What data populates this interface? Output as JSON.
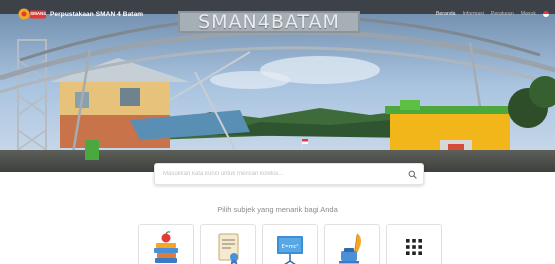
{
  "brand": {
    "logo_text": "SMAN4",
    "title": "Perpustakaan SMAN 4 Batam"
  },
  "nav": {
    "links": [
      "Beranda",
      "Informasi",
      "Peraturan",
      "Masuk"
    ],
    "flag_icon": "indonesia-flag-icon"
  },
  "hero": {
    "gate_sign": "SMAN4BATAM"
  },
  "search": {
    "placeholder": "Masukkan kata kunci untuk mencari koleksi...",
    "icon": "search-icon"
  },
  "subjects": {
    "heading": "Pilih subjek yang menarik bagi Anda",
    "items": [
      {
        "icon": "books-apple-icon"
      },
      {
        "icon": "certificate-document-icon"
      },
      {
        "icon": "presentation-board-icon"
      },
      {
        "icon": "ink-quill-icon"
      },
      {
        "icon": "grid-more-icon"
      }
    ]
  },
  "colors": {
    "accent": "#f5a623",
    "brand_red": "#e53935",
    "sky": "#b9d3ec"
  }
}
